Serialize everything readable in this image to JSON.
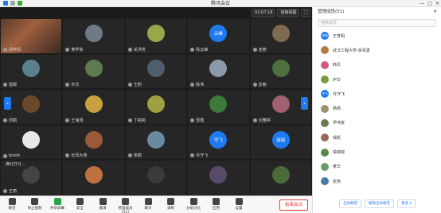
{
  "window": {
    "title": "腾讯会议",
    "controls": [
      "—",
      "□",
      "✕"
    ]
  },
  "topbar": {
    "timer": "02:07:18",
    "view_label": "宫格视图",
    "fullscreen_label": "⛶"
  },
  "grid": {
    "cells": [
      {
        "name": "闷哼闷",
        "avatar_text": "",
        "avatar_color": "#7a4a3a",
        "video": true
      },
      {
        "name": "黄学良",
        "avatar_text": "",
        "avatar_color": "#6e7a88"
      },
      {
        "name": "关洪亮",
        "avatar_text": "",
        "avatar_color": "#9aa64a"
      },
      {
        "name": "陈云峰",
        "avatar_text": "云峰",
        "avatar_color": "#1e7af0"
      },
      {
        "name": "亚丽",
        "avatar_text": "",
        "avatar_color": "#7f6a52"
      },
      {
        "name": "留邮",
        "avatar_text": "",
        "avatar_color": "#5a7f8f"
      },
      {
        "name": "许华",
        "avatar_text": "",
        "avatar_color": "#5e7a4e"
      },
      {
        "name": "王刚",
        "avatar_text": "",
        "avatar_color": "#4e5e6e"
      },
      {
        "name": "陈伟",
        "avatar_text": "",
        "avatar_color": "#8a9aa8"
      },
      {
        "name": "彭丽",
        "avatar_text": "",
        "avatar_color": "#4f6f3e"
      },
      {
        "name": "邓丽",
        "avatar_text": "",
        "avatar_color": "#6a4a2a"
      },
      {
        "name": "王海涛",
        "avatar_text": "",
        "avatar_color": "#c8a040"
      },
      {
        "name": "丁莉莉",
        "avatar_text": "",
        "avatar_color": "#a0a040"
      },
      {
        "name": "雷霞",
        "avatar_text": "",
        "avatar_color": "#3a7a3a"
      },
      {
        "name": "刘雅婷",
        "avatar_text": "",
        "avatar_color": "#a06070"
      },
      {
        "name": "brook",
        "avatar_text": "",
        "avatar_color": "#e8e8e8"
      },
      {
        "name": "长风大侠",
        "avatar_text": "",
        "avatar_color": "#9a5a3a"
      },
      {
        "name": "张丽",
        "avatar_text": "",
        "avatar_color": "#6a8aa0"
      },
      {
        "name": "许守飞",
        "avatar_text": "守飞",
        "avatar_color": "#1e7af0"
      },
      {
        "name": "",
        "avatar_text": "丽丽",
        "avatar_color": "#1e7af0"
      },
      {
        "name": "王丽",
        "avatar_text": "",
        "avatar_color": "#444444"
      },
      {
        "name": "",
        "avatar_text": "",
        "avatar_color": "#c07040"
      },
      {
        "name": "",
        "avatar_text": "",
        "avatar_color": "#3a3a3a"
      },
      {
        "name": "",
        "avatar_text": "",
        "avatar_color": "#5a4a6a"
      },
      {
        "name": "",
        "avatar_text": "",
        "avatar_color": "#4a6a3a"
      }
    ],
    "chat_popup": "满分打分..."
  },
  "toolbar": {
    "items": [
      {
        "label": "静音",
        "icon": "mic-icon"
      },
      {
        "label": "停止视频",
        "icon": "camera-icon"
      },
      {
        "label": "共享屏幕",
        "icon": "share-screen-icon"
      },
      {
        "label": "安全",
        "icon": "shield-icon"
      },
      {
        "label": "邀请",
        "icon": "invite-icon"
      },
      {
        "label": "管理成员(51)",
        "icon": "members-icon"
      },
      {
        "label": "聊天",
        "icon": "chat-icon"
      },
      {
        "label": "录制",
        "icon": "record-icon"
      },
      {
        "label": "分组讨论",
        "icon": "breakout-icon"
      },
      {
        "label": "应用",
        "icon": "apps-icon"
      },
      {
        "label": "设置",
        "icon": "gear-icon"
      }
    ],
    "end_label": "结束会议"
  },
  "panel": {
    "title": "管理成员(51)",
    "search_placeholder": "搜索成员",
    "members": [
      {
        "name": "王育明",
        "avatar_text": "育明",
        "avatar_color": "#1e7af0"
      },
      {
        "name": "武汉工程大学-余军勇",
        "avatar_text": "",
        "avatar_color": "#b07a40"
      },
      {
        "name": "西贝",
        "avatar_text": "",
        "avatar_color": "#d05a7a"
      },
      {
        "name": "庐华",
        "avatar_text": "",
        "avatar_color": "#7a9a40"
      },
      {
        "name": "许守飞",
        "avatar_text": "守飞",
        "avatar_color": "#1e7af0"
      },
      {
        "name": "杨扬",
        "avatar_text": "",
        "avatar_color": "#a09070"
      },
      {
        "name": "尹伟俊",
        "avatar_text": "",
        "avatar_color": "#6a7a50"
      },
      {
        "name": "邹凯",
        "avatar_text": "",
        "avatar_color": "#9a6a5a"
      },
      {
        "name": "喻晴琪",
        "avatar_text": "",
        "avatar_color": "#5a8a4a"
      },
      {
        "name": "黄华",
        "avatar_text": "",
        "avatar_color": "#6a9a6a"
      },
      {
        "name": "张燕",
        "avatar_text": "",
        "avatar_color": "#4a7aa0"
      }
    ],
    "buttons": [
      "全体静音",
      "解除全体静音",
      "更多 ▾"
    ]
  }
}
